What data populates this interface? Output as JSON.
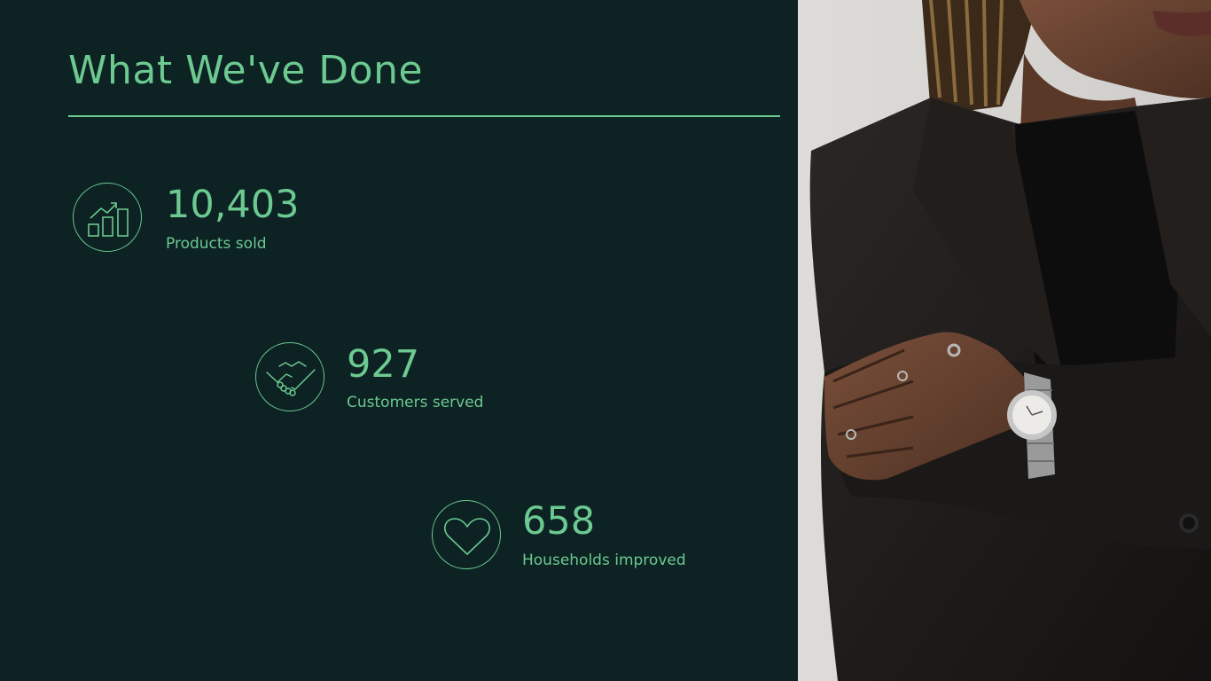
{
  "slide": {
    "title": "What We've Done"
  },
  "stats": [
    {
      "value": "10,403",
      "label": "Products sold",
      "icon": "bar-chart-icon"
    },
    {
      "value": "927",
      "label": "Customers served",
      "icon": "handshake-icon"
    },
    {
      "value": "658",
      "label": "Households improved",
      "icon": "heart-icon"
    }
  ],
  "colors": {
    "background": "#0c2223",
    "accent": "#6cc990"
  }
}
